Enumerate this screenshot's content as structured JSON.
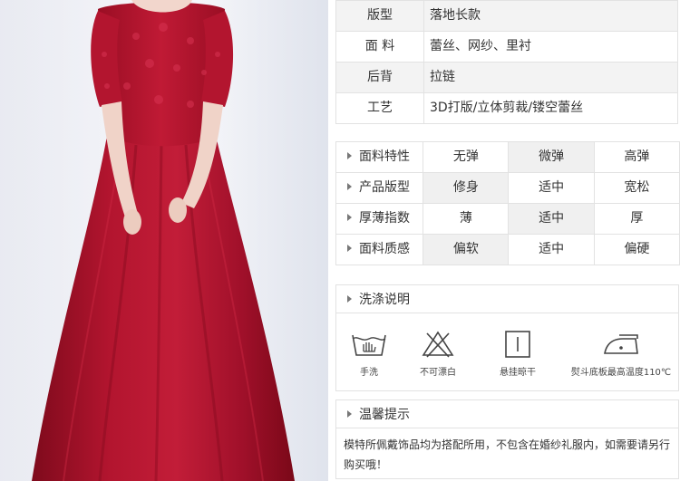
{
  "specs": [
    {
      "label": "版型",
      "value": "落地长款"
    },
    {
      "label": "面 料",
      "value": "蕾丝、网纱、里衬"
    },
    {
      "label": "后背",
      "value": "拉链"
    },
    {
      "label": "工艺",
      "value": "3D打版/立体剪裁/镂空蕾丝"
    }
  ],
  "attributes": [
    {
      "label": "面料特性",
      "options": [
        "无弹",
        "微弹",
        "高弹"
      ],
      "selected": "微弹"
    },
    {
      "label": "产品版型",
      "options": [
        "修身",
        "适中",
        "宽松"
      ],
      "selected": "修身"
    },
    {
      "label": "厚薄指数",
      "options": [
        "薄",
        "适中",
        "厚"
      ],
      "selected": "适中"
    },
    {
      "label": "面料质感",
      "options": [
        "偏软",
        "适中",
        "偏硬"
      ],
      "selected": "偏软"
    }
  ],
  "wash": {
    "title": "洗涤说明",
    "items": [
      {
        "icon": "hand-wash-icon",
        "label": "手洗"
      },
      {
        "icon": "no-bleach-icon",
        "label": "不可漂白"
      },
      {
        "icon": "hang-dry-icon",
        "label": "悬挂晾干"
      },
      {
        "icon": "iron-icon",
        "label": "熨斗底板最高温度110℃"
      }
    ]
  },
  "tips": {
    "title": "温馨提示",
    "text": "模特所佩戴饰品均为搭配所用，不包含在婚纱礼服内，如需要请另行购买哦！"
  },
  "colors": {
    "dress": "#a8102a",
    "border": "#e2e2e2",
    "row_alt": "#f3f3f3",
    "selected_cell": "#f0f0f0"
  }
}
